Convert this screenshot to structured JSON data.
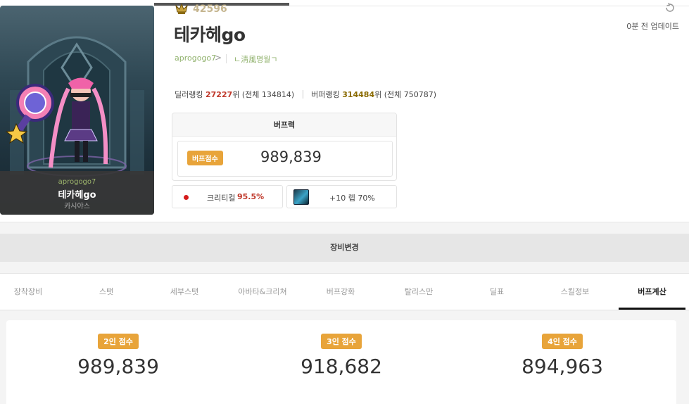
{
  "character": {
    "fame": "42596",
    "name": "테카헤go",
    "adventure": "aprogogo7",
    "adventure_arrow": ">",
    "guild": "ㄴ淸風명월ㄱ",
    "update_text": "0분 전 업데이트"
  },
  "portrait": {
    "adventure": "aprogogo7",
    "name": "테카헤go",
    "server": "카시야스"
  },
  "ranking": {
    "dealer_label": "딜러랭킹",
    "dealer_rank": "27227",
    "dealer_suffix": "위 (전체 134814)",
    "buffer_label": "버퍼랭킹",
    "buffer_rank": "314484",
    "buffer_suffix": "위 (전체 750787)"
  },
  "buff": {
    "title": "버프력",
    "badge": "버프점수",
    "score": "989,839",
    "crit_label": "크리티컬",
    "crit_value": "95.5%",
    "item_label": "+10 렙 70%"
  },
  "equip_change": "장비변경",
  "tabs": [
    {
      "label": "장착장비"
    },
    {
      "label": "스탯"
    },
    {
      "label": "세부스탯"
    },
    {
      "label": "아바타&크리쳐"
    },
    {
      "label": "버프강화"
    },
    {
      "label": "탈리스만"
    },
    {
      "label": "딜표"
    },
    {
      "label": "스킬정보"
    },
    {
      "label": "버프계산"
    }
  ],
  "active_tab": "버프계산",
  "scores": [
    {
      "label": "2인 점수",
      "value": "989,839"
    },
    {
      "label": "3인 점수",
      "value": "918,682"
    },
    {
      "label": "4인 점수",
      "value": "894,963"
    }
  ],
  "colors": {
    "accent": "#e8a43a",
    "crit_red": "#c0392b",
    "adventure_green": "#8fb16b"
  },
  "icons": {
    "fame": "fame-medal-icon",
    "update": "refresh-icon",
    "crit": "red-dot-icon",
    "item": "weapon-item-icon"
  }
}
